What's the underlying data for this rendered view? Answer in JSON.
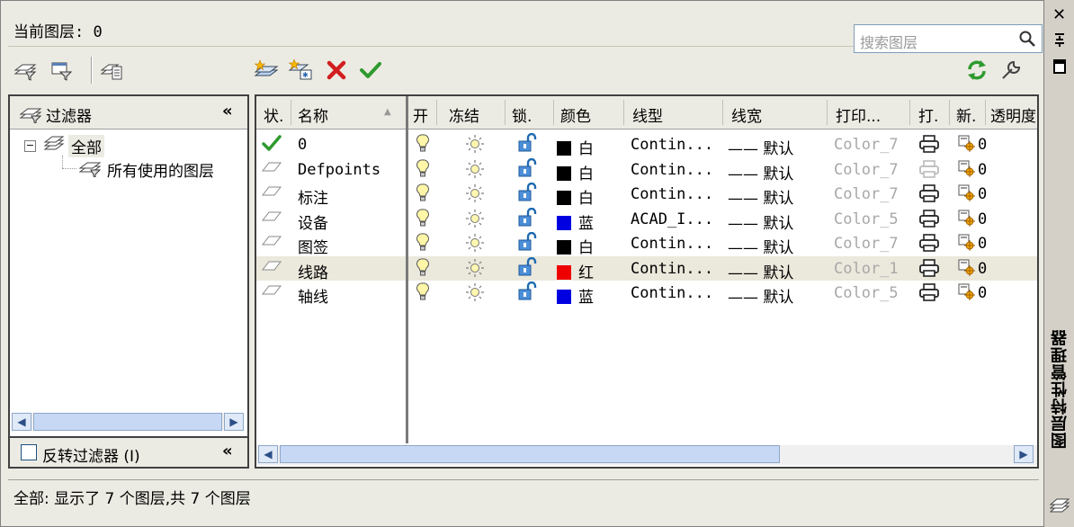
{
  "current_layer": {
    "label": "当前图层: 0"
  },
  "search": {
    "placeholder": "搜索图层"
  },
  "toolbar": {
    "left_icons": [
      "new-property-filter-icon",
      "new-group-filter-icon",
      "layer-states-manager-icon"
    ],
    "mid_icons": [
      "new-layer-icon",
      "new-layer-vp-frozen-icon",
      "delete-layer-icon",
      "set-current-icon"
    ],
    "right_icons": [
      "refresh-icon",
      "settings-icon"
    ]
  },
  "filters": {
    "header": "过滤器",
    "collapse": "«",
    "tree": [
      {
        "label": "全部",
        "level": 0
      },
      {
        "label": "所有使用的图层",
        "level": 1
      }
    ],
    "invert_label": "反转过滤器 (I)"
  },
  "layers": {
    "columns": [
      "状.",
      "名称",
      "开",
      "冻结",
      "锁.",
      "颜色",
      "线型",
      "线宽",
      "打印...",
      "打.",
      "新.",
      "透明度"
    ],
    "rows": [
      {
        "status": "current",
        "name": "0",
        "color_name": "白",
        "color": "#000000",
        "linetype": "Contin...",
        "lineweight": "—— 默认",
        "plot_style": "Color_7",
        "plot": true,
        "transparency": "0",
        "selected": false
      },
      {
        "status": "layer",
        "name": "Defpoints",
        "color_name": "白",
        "color": "#000000",
        "linetype": "Contin...",
        "lineweight": "—— 默认",
        "plot_style": "Color_7",
        "plot": false,
        "transparency": "0",
        "selected": false
      },
      {
        "status": "layer",
        "name": "标注",
        "color_name": "白",
        "color": "#000000",
        "linetype": "Contin...",
        "lineweight": "—— 默认",
        "plot_style": "Color_7",
        "plot": true,
        "transparency": "0",
        "selected": false
      },
      {
        "status": "layer",
        "name": "设备",
        "color_name": "蓝",
        "color": "#0000e0",
        "linetype": "ACAD_I...",
        "lineweight": "—— 默认",
        "plot_style": "Color_5",
        "plot": true,
        "transparency": "0",
        "selected": false
      },
      {
        "status": "layer",
        "name": "图签",
        "color_name": "白",
        "color": "#000000",
        "linetype": "Contin...",
        "lineweight": "—— 默认",
        "plot_style": "Color_7",
        "plot": true,
        "transparency": "0",
        "selected": false
      },
      {
        "status": "layer",
        "name": "线路",
        "color_name": "红",
        "color": "#ee0000",
        "linetype": "Contin...",
        "lineweight": "—— 默认",
        "plot_style": "Color_1",
        "plot": true,
        "transparency": "0",
        "selected": true
      },
      {
        "status": "layer",
        "name": "轴线",
        "color_name": "蓝",
        "color": "#0000e0",
        "linetype": "Contin...",
        "lineweight": "—— 默认",
        "plot_style": "Color_5",
        "plot": true,
        "transparency": "0",
        "selected": false
      }
    ]
  },
  "status_text": "全部: 显示了 7 个图层,共 7 个图层",
  "palette": {
    "title": "图层特性管理器",
    "close": "✕"
  }
}
